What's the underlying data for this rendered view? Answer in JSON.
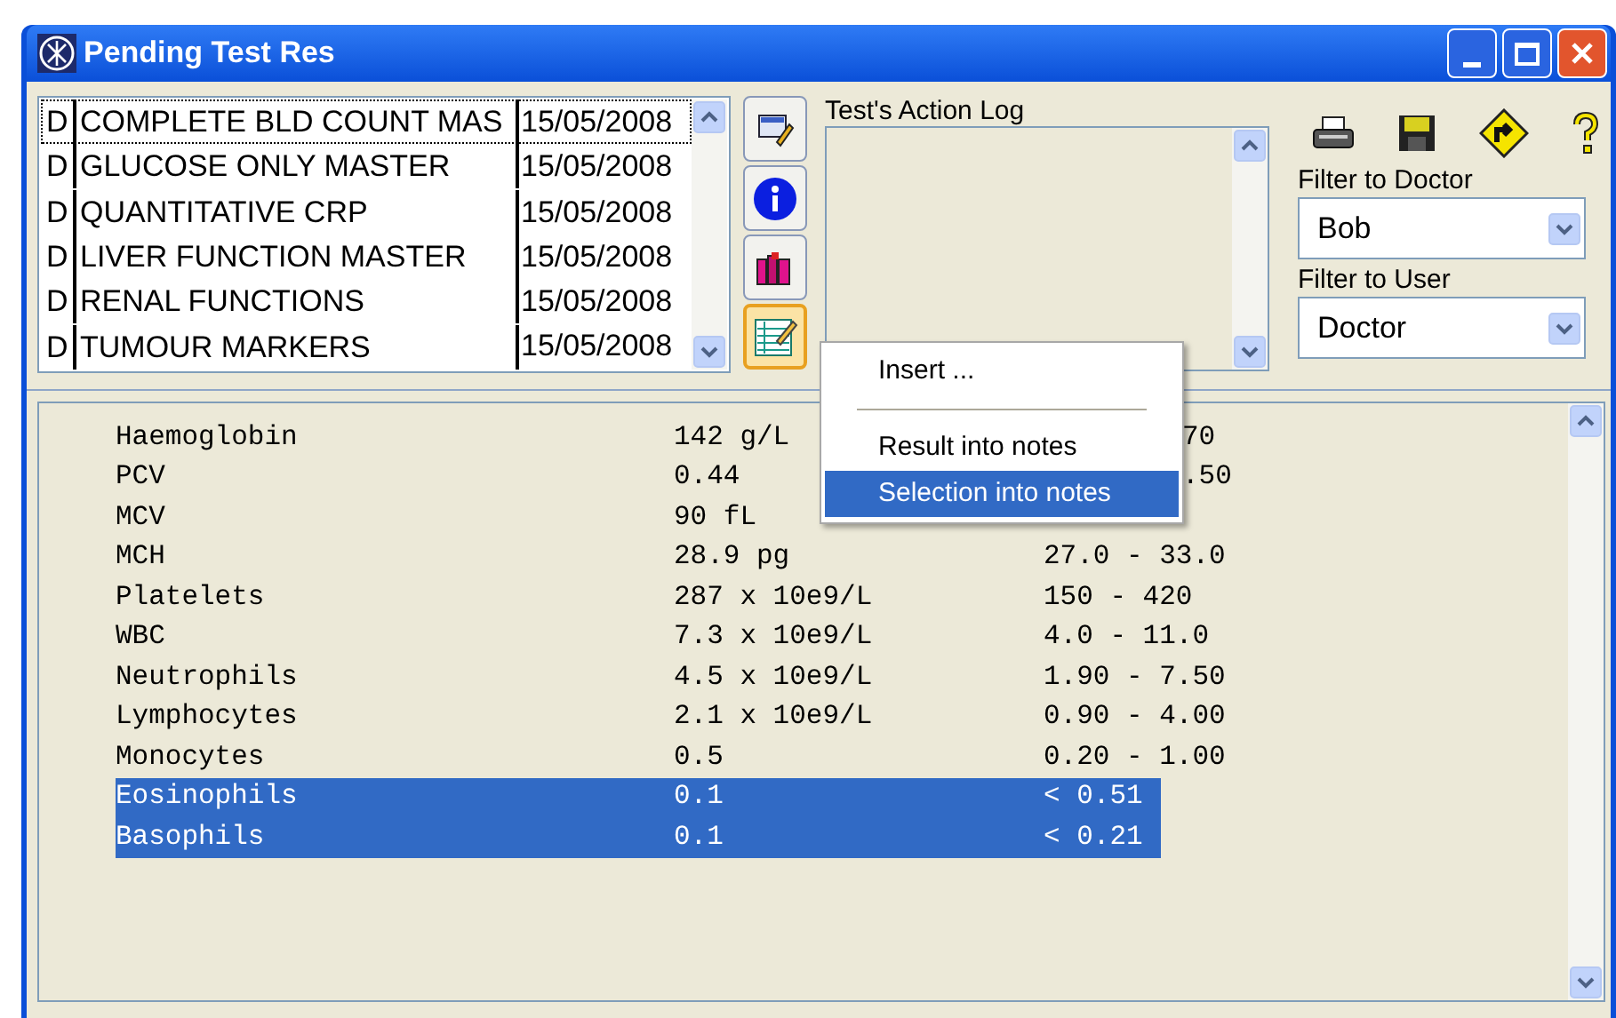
{
  "window": {
    "title": "Pending Test Res"
  },
  "tests": [
    {
      "flag": "D",
      "name": "COMPLETE BLD COUNT MAS",
      "date": "15/05/2008",
      "selected": true
    },
    {
      "flag": "D",
      "name": "GLUCOSE ONLY MASTER",
      "date": "15/05/2008",
      "selected": false
    },
    {
      "flag": "D",
      "name": "QUANTITATIVE CRP",
      "date": "15/05/2008",
      "selected": false
    },
    {
      "flag": "D",
      "name": "LIVER FUNCTION MASTER",
      "date": "15/05/2008",
      "selected": false
    },
    {
      "flag": "D",
      "name": "RENAL FUNCTIONS",
      "date": "15/05/2008",
      "selected": false
    },
    {
      "flag": "D",
      "name": "TUMOUR MARKERS",
      "date": "15/05/2008",
      "selected": false
    }
  ],
  "side_buttons": [
    {
      "kind": "edit"
    },
    {
      "kind": "info"
    },
    {
      "kind": "books"
    },
    {
      "kind": "notes",
      "selected": true
    }
  ],
  "action_log": {
    "label": "Test's Action Log"
  },
  "filters": [
    {
      "label": "Filter to Doctor",
      "value": "Bob"
    },
    {
      "label": "Filter to User",
      "value": "Doctor"
    }
  ],
  "results": [
    {
      "name": "Haemoglobin",
      "value": "142 g/L",
      "range": "70",
      "clipped": true,
      "selected": false
    },
    {
      "name": "PCV",
      "value": "0.44",
      "range": ".50",
      "clipped": true,
      "selected": false
    },
    {
      "name": "MCV",
      "value": "90 fL",
      "selected": false
    },
    {
      "name": "MCH",
      "value": "28.9 pg",
      "range": "27.0 - 33.0",
      "selected": false
    },
    {
      "name": "Platelets",
      "value": "287 x 10e9/L",
      "range": "150 - 420",
      "selected": false
    },
    {
      "name": "WBC",
      "value": "7.3 x 10e9/L",
      "range": "4.0 - 11.0",
      "selected": false
    },
    {
      "name": "Neutrophils",
      "value": "4.5 x 10e9/L",
      "range": "1.90 - 7.50",
      "selected": false
    },
    {
      "name": "Lymphocytes",
      "value": "2.1 x 10e9/L",
      "range": "0.90 - 4.00",
      "selected": false
    },
    {
      "name": "Monocytes",
      "value": "0.5",
      "range": "0.20 - 1.00",
      "selected": false
    },
    {
      "name": "Eosinophils",
      "value": "0.1",
      "range": "< 0.51",
      "selected": true
    },
    {
      "name": "Basophils",
      "value": "0.1",
      "range": "< 0.21",
      "selected": true
    }
  ],
  "context_menu": [
    {
      "label": "Insert ...",
      "kind": "item",
      "selected": false
    },
    {
      "kind": "separator"
    },
    {
      "label": "Result into notes",
      "kind": "item",
      "selected": false
    },
    {
      "label": "Selection into notes",
      "kind": "item",
      "selected": true
    }
  ]
}
